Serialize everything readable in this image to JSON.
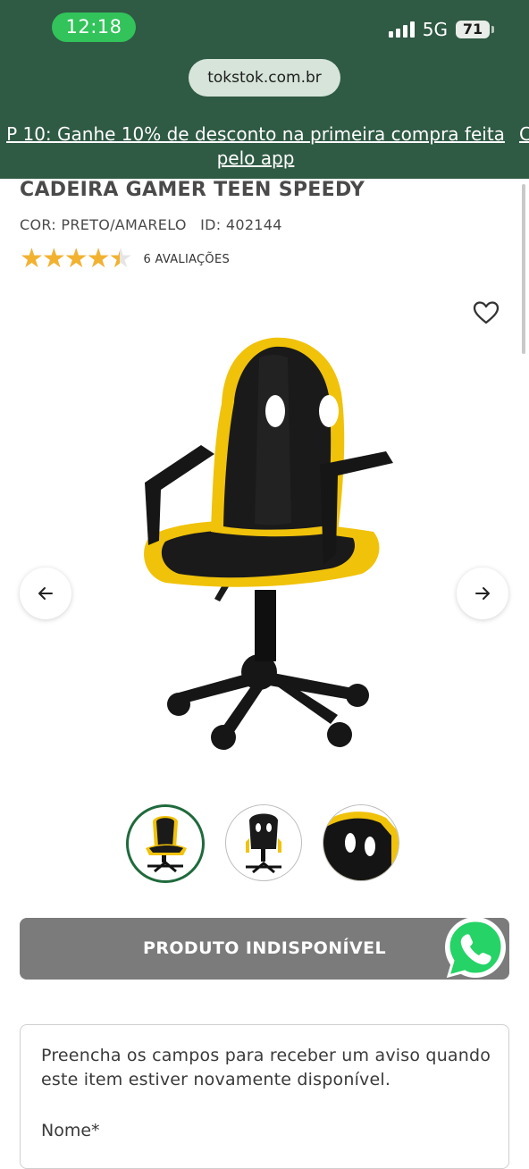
{
  "status_bar": {
    "time": "12:18",
    "network": "5G",
    "battery": "71"
  },
  "browser": {
    "url": "tokstok.com.br"
  },
  "promo": {
    "text": "P 10: Ganhe 10% de desconto na primeira compra feita pelo app",
    "next_fragment": "C"
  },
  "product": {
    "title": "CADEIRA GAMER TEEN SPEEDY",
    "color": "COR: PRETO/AMARELO",
    "id": "ID: 402144",
    "rating": 4.5,
    "rating_max": 5,
    "reviews": "6 AVALIAÇÕES"
  },
  "gallery": {
    "thumbnail_count": 3,
    "selected_index": 0
  },
  "actions": {
    "unavailable_label": "PRODUTO INDISPONÍVEL"
  },
  "notify_form": {
    "message": "Preencha os campos para receber um aviso quando este item estiver novamente disponível.",
    "name_label": "Nome*"
  },
  "colors": {
    "header_green": "#2f5a44",
    "accent_green": "#1f6a3c",
    "star": "#f2b230",
    "disabled_button": "#7b7b7b",
    "whatsapp": "#25d366"
  },
  "icons": [
    "signal-icon",
    "heart-icon",
    "arrow-left-icon",
    "arrow-right-icon",
    "whatsapp-icon"
  ]
}
